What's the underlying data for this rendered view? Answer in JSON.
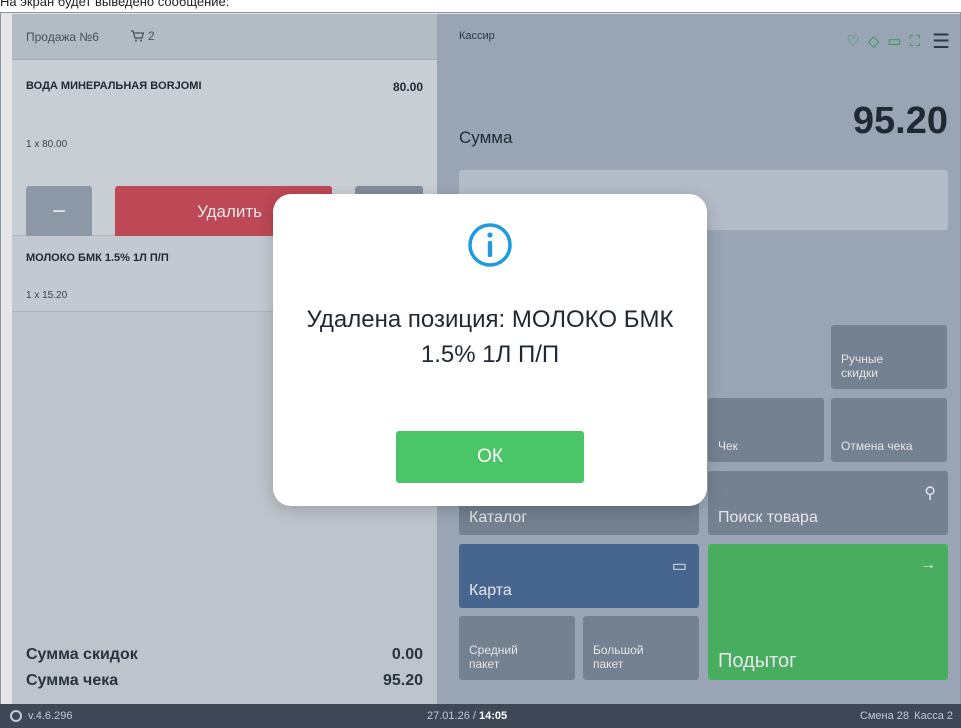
{
  "caption": "На экран будет выведено сообщение:",
  "left": {
    "sale_title": "Продажа №6",
    "cart_count": "2",
    "items": [
      {
        "name": "ВОДА МИНЕРАЛЬНАЯ BORJOMI",
        "price": "80.00",
        "qty": "1 х 80.00"
      },
      {
        "name": "МОЛОКО БМК 1.5% 1Л П/П",
        "qty": "1 х 15.20"
      }
    ],
    "delete_label": "Удалить",
    "minus_label": "−",
    "plus_label": "+",
    "discount_label": "Сумма скидок",
    "discount_value": "0.00",
    "total_label": "Сумма чека",
    "total_value": "95.20"
  },
  "right": {
    "cashier": "Кассир",
    "sum_label": "Сумма",
    "sum_value": "95.20",
    "tiles": {
      "manual_discounts": "Ручные скидки",
      "receipt": "Чек",
      "cancel_receipt": "Отмена чека",
      "catalog": "Каталог",
      "search": "Поиск товара",
      "card": "Карта",
      "medium_bag": "Средний пакет",
      "large_bag": "Большой пакет",
      "subtotal": "Подытог"
    }
  },
  "footer": {
    "version": "v.4.6.296",
    "date": "27.01.26",
    "time": "14:05",
    "shift": "Смена 28",
    "kassa": "Касса 2"
  },
  "modal": {
    "message": "Удалена позиция: МОЛОКО БМК 1.5% 1Л П/П",
    "ok_label": "ОК"
  },
  "colors": {
    "delete": "#d24d5a",
    "ok": "#4ac668",
    "subtotal": "#4dbf64",
    "card": "#4a6e9c",
    "info": "#1e9be0"
  }
}
